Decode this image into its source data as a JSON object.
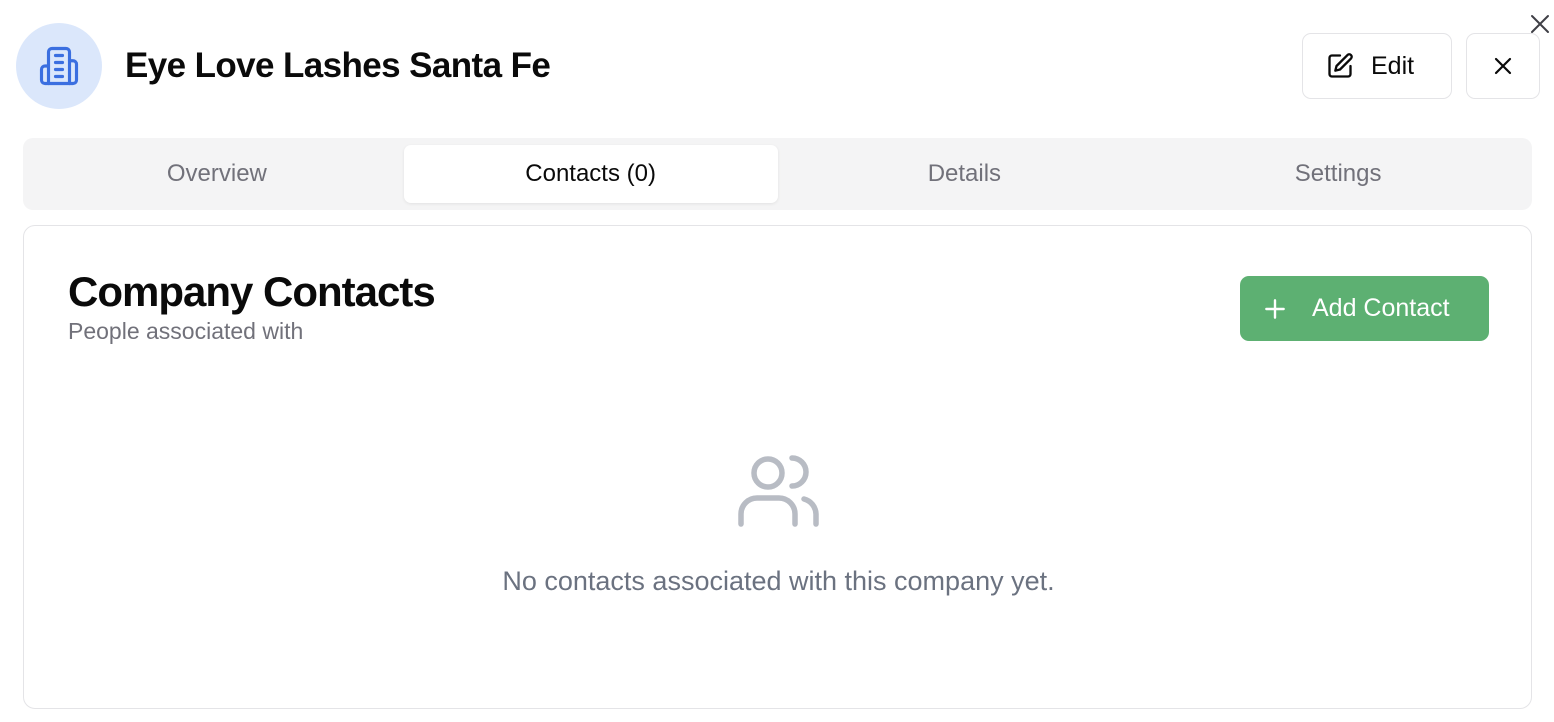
{
  "header": {
    "company_name": "Eye Love Lashes Santa Fe",
    "avatar_icon": "building-icon",
    "edit_label": "Edit"
  },
  "tabs": [
    {
      "label": "Overview",
      "active": false
    },
    {
      "label": "Contacts (0)",
      "active": true
    },
    {
      "label": "Details",
      "active": false
    },
    {
      "label": "Settings",
      "active": false
    }
  ],
  "contacts_panel": {
    "title": "Company Contacts",
    "subtitle": "People associated with",
    "add_button_label": "Add Contact",
    "empty_icon": "users-icon",
    "empty_message": "No contacts associated with this company yet."
  },
  "colors": {
    "accent_green": "#5db072",
    "avatar_bg": "#dbe7fb",
    "avatar_icon": "#3b6fe0",
    "muted_text": "#71717a",
    "empty_icon": "#b8bcc4"
  }
}
